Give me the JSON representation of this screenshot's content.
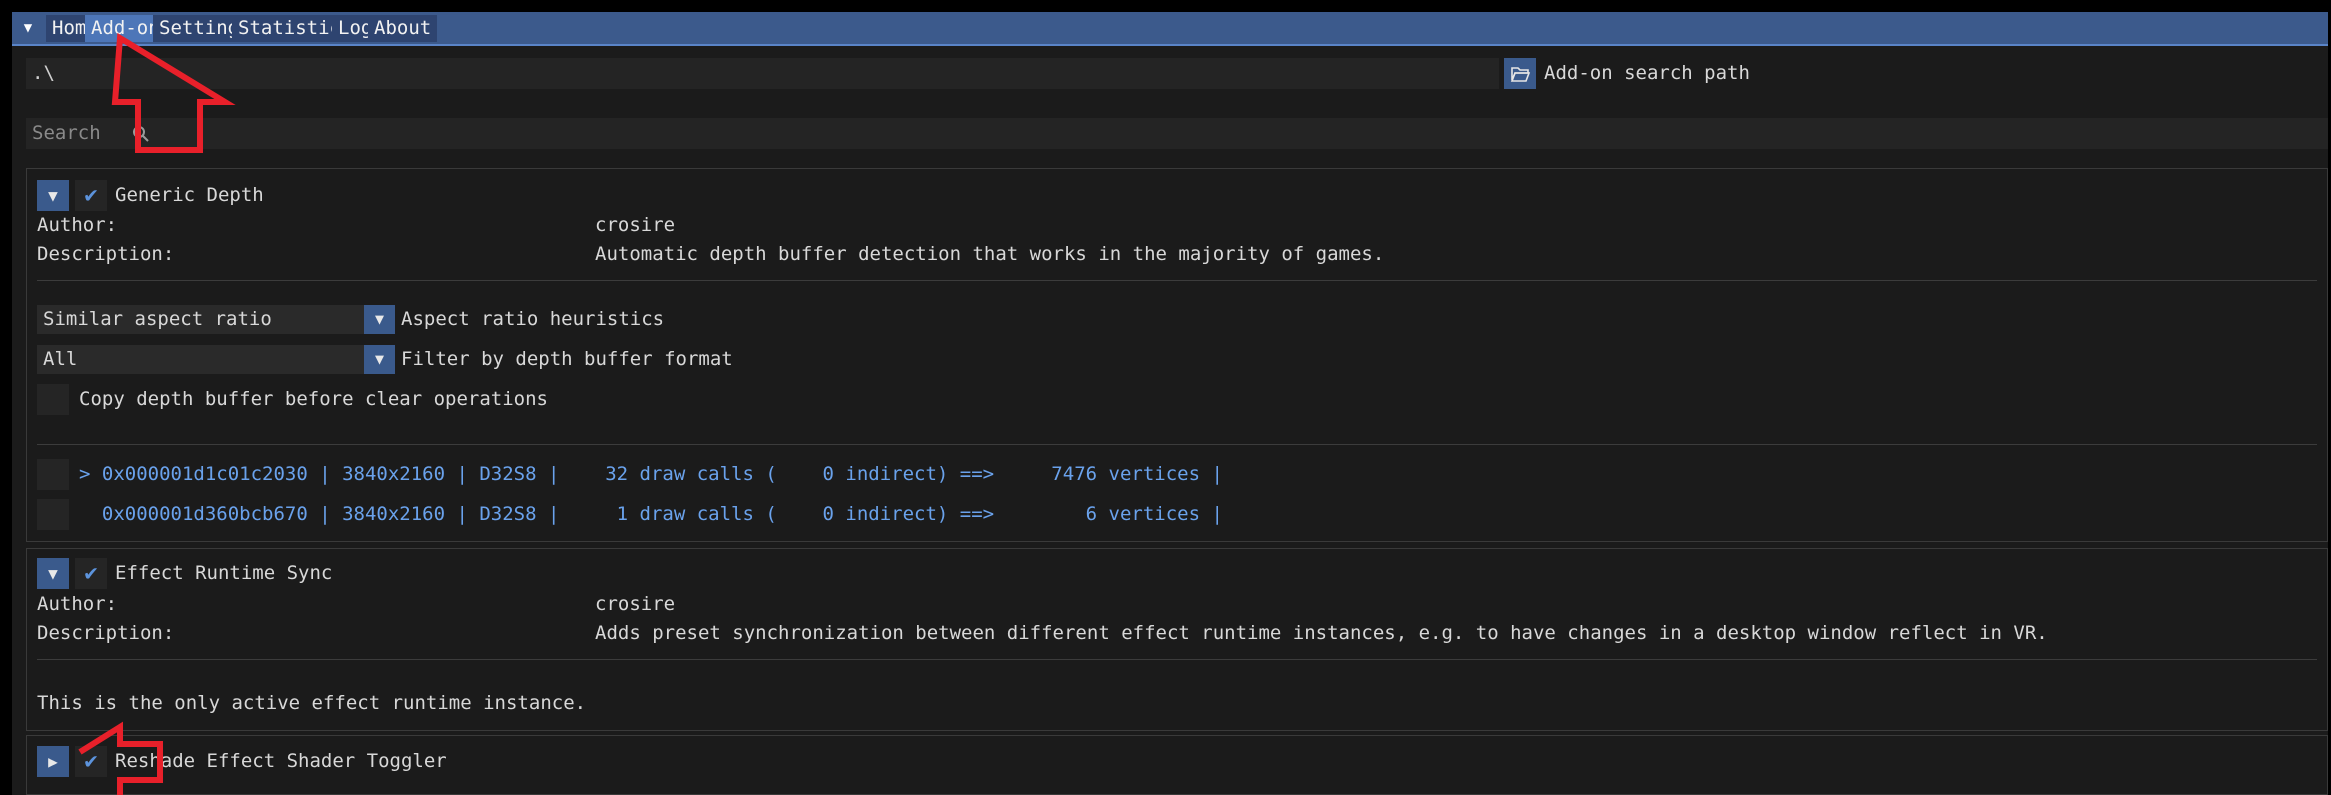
{
  "tabs": [
    {
      "label": "Home"
    },
    {
      "label": "Add-ons"
    },
    {
      "label": "Settings"
    },
    {
      "label": "Statistics"
    },
    {
      "label": "Log"
    },
    {
      "label": "About"
    }
  ],
  "menu_arrow": "▼",
  "path": {
    "value": ".\\",
    "button_label": "Add-on search path"
  },
  "search": {
    "placeholder": "Search"
  },
  "addons": [
    {
      "name": "Generic Depth",
      "author_label": "Author:",
      "author": "crosire",
      "description_label": "Description:",
      "description": "Automatic depth buffer detection that works in the majority of games.",
      "aspect_combo_value": "Similar aspect ratio",
      "aspect_combo_label": "Aspect ratio heuristics",
      "format_combo_value": "All",
      "format_combo_label": "Filter by depth buffer format",
      "copy_label": "Copy depth buffer before clear operations",
      "buffers": [
        "> 0x000001d1c01c2030 | 3840x2160 | D32S8 |    32 draw calls (    0 indirect) ==>     7476 vertices |",
        "  0x000001d360bcb670 | 3840x2160 | D32S8 |     1 draw calls (    0 indirect) ==>        6 vertices |"
      ]
    },
    {
      "name": "Effect Runtime Sync",
      "author_label": "Author:",
      "author": "crosire",
      "description_label": "Description:",
      "description": "Adds preset synchronization between different effect runtime instances, e.g. to have changes in a desktop window reflect in VR.",
      "info": "This is the only active effect runtime instance."
    },
    {
      "name": "Reshade Effect Shader Toggler"
    }
  ],
  "colors": {
    "accent": "#3a5a8c",
    "tab_active": "#4d76b8",
    "annotation": "#e8202a"
  }
}
